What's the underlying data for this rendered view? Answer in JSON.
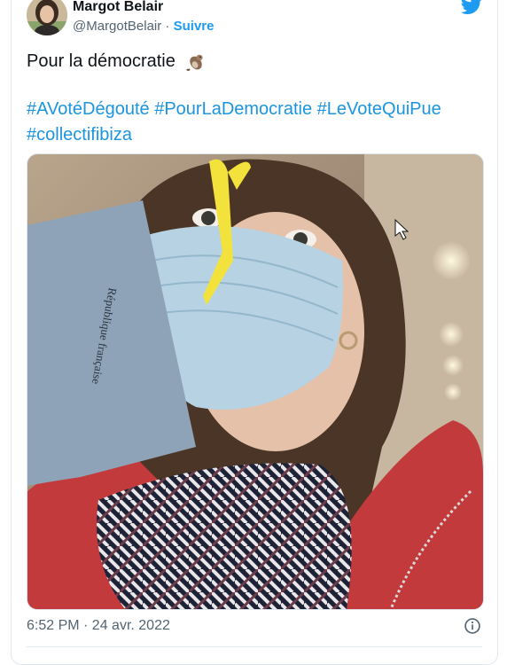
{
  "tweet": {
    "author_name": "Margot Belair",
    "handle": "@MargotBelair",
    "separator": " · ",
    "follow_label": "Suivre",
    "text": "Pour la démocratie",
    "hashtags": [
      "#AVotéDégouté",
      "#PourLaDemocratie",
      "#LeVoteQuiPue",
      "#collectifibiza"
    ],
    "timestamp": "6:52 PM · 24 avr. 2022",
    "envelope_print": "République française"
  },
  "icons": {
    "brand": "twitter-bird-icon",
    "emoji": "otter-emoji",
    "info": "info-icon"
  },
  "colors": {
    "link": "#1b95e0",
    "follow": "#1d9bf0",
    "muted": "#536471",
    "border": "#e1e8ed"
  }
}
